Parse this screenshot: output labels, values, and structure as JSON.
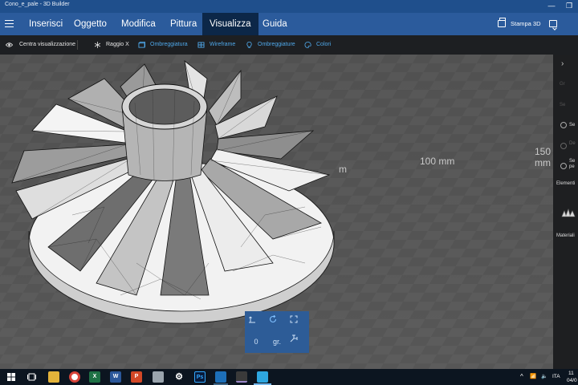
{
  "window": {
    "title": "Cono_e_pale - 3D Builder",
    "minimize_glyph": "—",
    "restore_glyph": "❐"
  },
  "menu": {
    "tabs": [
      {
        "label": "Inserisci"
      },
      {
        "label": "Oggetto"
      },
      {
        "label": "Modifica"
      },
      {
        "label": "Pittura"
      },
      {
        "label": "Visualizza",
        "active": true
      },
      {
        "label": "Guida"
      }
    ],
    "print_label": "Stampa 3D"
  },
  "toolbar": {
    "items": [
      {
        "label": "Centra visualizzazione",
        "icon": "eye-icon",
        "active": false
      },
      {
        "label": "Raggio X",
        "icon": "xray-icon",
        "active": false
      },
      {
        "label": "Ombreggiatura",
        "icon": "shading-icon",
        "active": true
      },
      {
        "label": "Wireframe",
        "icon": "wireframe-icon",
        "active": true
      },
      {
        "label": "Ombreggiature",
        "icon": "lightbulb-icon",
        "active": true
      },
      {
        "label": "Colori",
        "icon": "palette-icon",
        "active": true
      }
    ],
    "accent_color": "#4fa8ea"
  },
  "viewport": {
    "grid_labels": [
      "100 mm",
      "150 mm",
      "m"
    ]
  },
  "nav_widget": {
    "buttons": [
      "move-icon",
      "rotate-icon",
      "fit-icon",
      "0",
      "gr.",
      "snap-icon"
    ],
    "angle_value": "0",
    "angle_unit": "gr."
  },
  "right_panel": {
    "items": [
      "Gr",
      "Se",
      "Se",
      "De",
      "Se pe"
    ],
    "sections": [
      "Elementi",
      "Materiali"
    ]
  },
  "taskbar": {
    "apps": [
      "start-icon",
      "task-view-icon",
      "file-explorer-icon",
      "chrome-icon",
      "excel-icon",
      "word-icon",
      "powerpoint-icon",
      "printer-app-icon",
      "settings-icon",
      "photoshop-icon",
      "presentation-app-icon",
      "3d-builder-icon"
    ],
    "tray_lang": "ITA",
    "clock_time": "11",
    "clock_date": "04/0"
  }
}
